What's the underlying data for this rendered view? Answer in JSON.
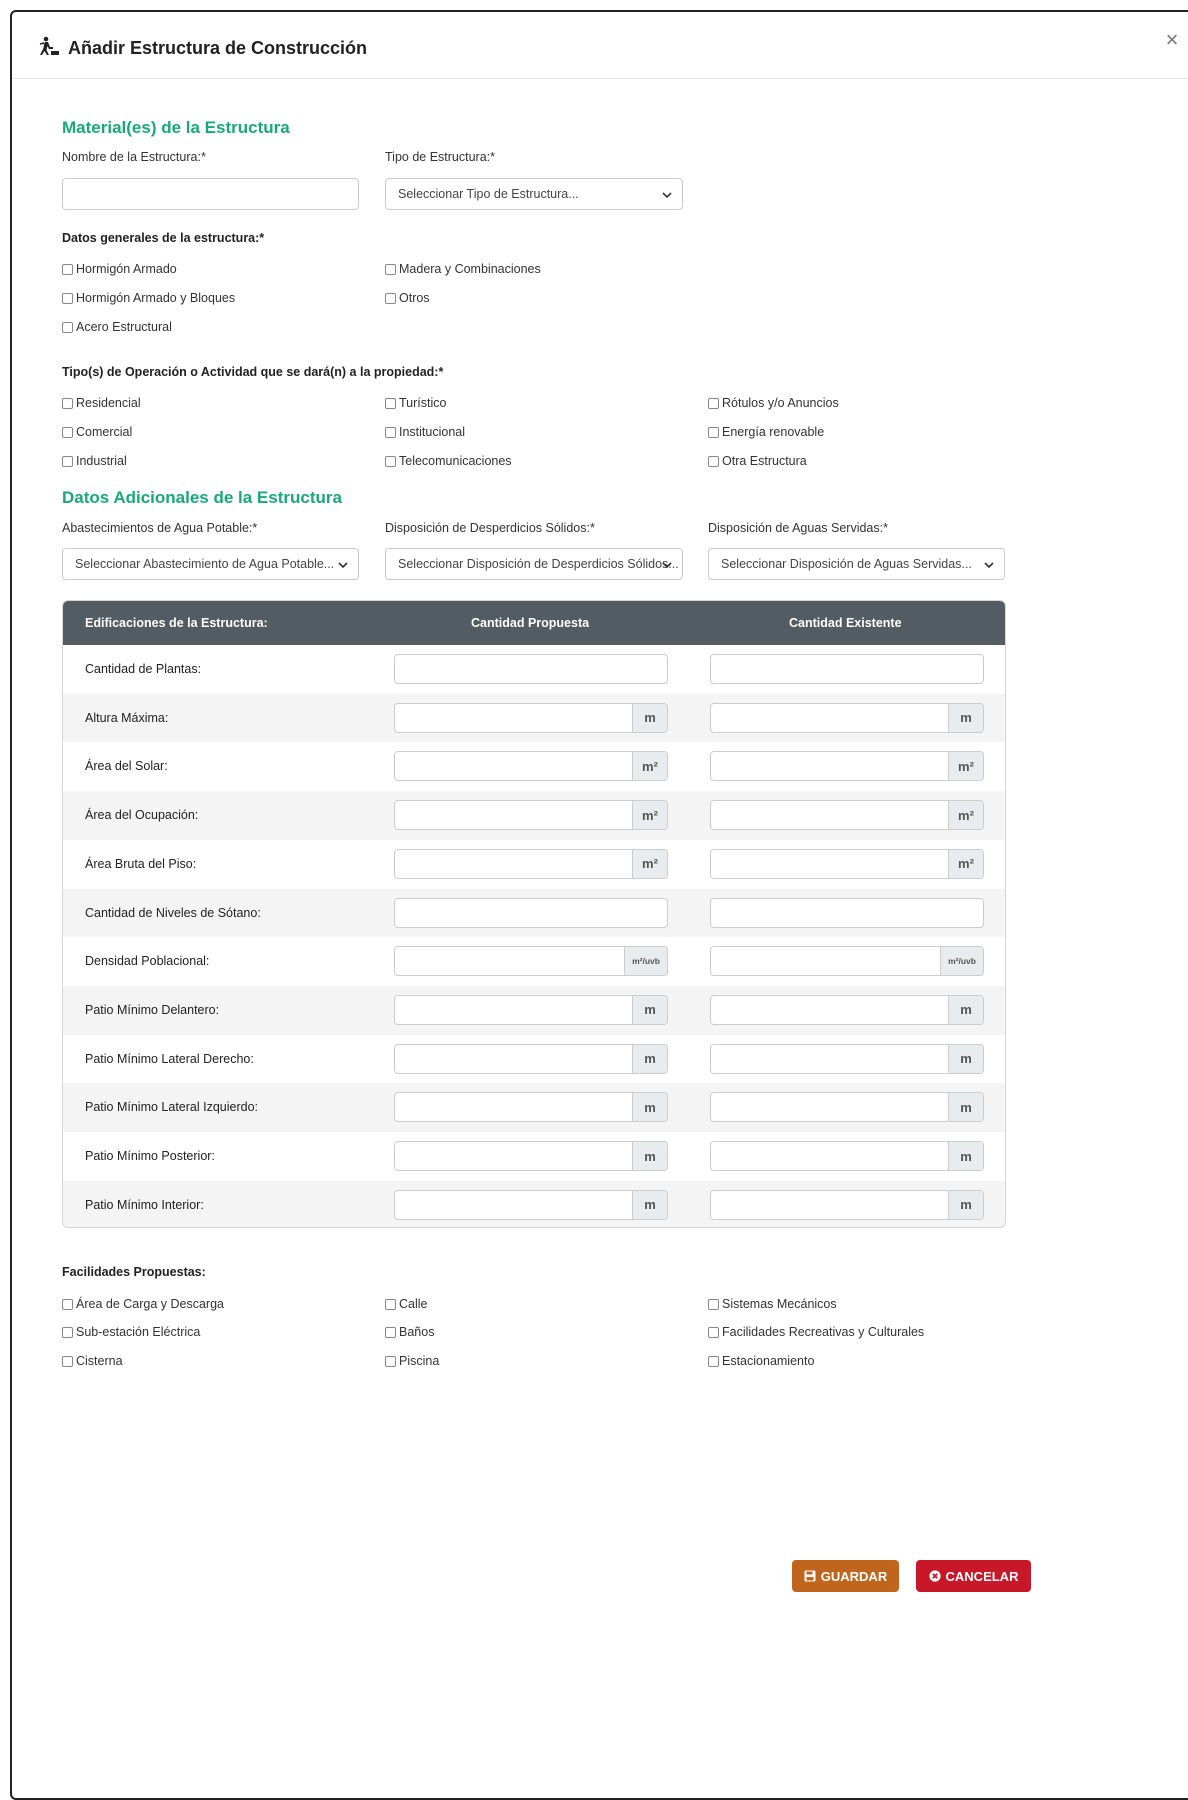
{
  "modal": {
    "title": "Añadir Estructura de Construcción",
    "close_symbol": "×",
    "title_icon": "worker-icon"
  },
  "colors": {
    "section": "#19a979",
    "table_header": "#525c62",
    "save": "#c0651e",
    "cancel": "#c9172a"
  },
  "section_materials": {
    "title": "Material(es) de la Estructura",
    "name_label": "Nombre de la Estructura:*",
    "name_value": "",
    "type_label": "Tipo de Estructura:*",
    "type_select": "Seleccionar Tipo de Estructura..."
  },
  "general_data": {
    "label": "Datos generales de la estructura:*",
    "options": [
      "Hormigón Armado",
      "Madera y Combinaciones",
      "Hormigón Armado y Bloques",
      "Otros",
      "Acero Estructural"
    ]
  },
  "operation_types": {
    "label": "Tipo(s) de Operación o Actividad que se dará(n) a la propiedad:*",
    "options": [
      "Residencial",
      "Turístico",
      "Rótulos y/o Anuncios",
      "Comercial",
      "Institucional",
      "Energía renovable",
      "Industrial",
      "Telecomunicaciones",
      "Otra Estructura"
    ]
  },
  "section_additional": {
    "title": "Datos Adicionales de la Estructura",
    "water_label": "Abastecimientos de Agua Potable:*",
    "water_select": "Seleccionar Abastecimiento de Agua Potable...",
    "solid_label": "Disposición de Desperdicios Sólidos:*",
    "solid_select": "Seleccionar Disposición de Desperdicios Sólidos...",
    "sewage_label": "Disposición de Aguas Servidas:*",
    "sewage_select": "Seleccionar Disposición de Aguas Servidas..."
  },
  "table": {
    "headers": [
      "Edificaciones de la Estructura:",
      "Cantidad Propuesta",
      "Cantidad Existente"
    ],
    "rows": [
      {
        "label": "Cantidad de Plantas:",
        "unit": ""
      },
      {
        "label": "Altura Máxima:",
        "unit": "m"
      },
      {
        "label": "Área del Solar:",
        "unit": "m²"
      },
      {
        "label": "Área del Ocupación:",
        "unit": "m²"
      },
      {
        "label": "Área Bruta del Piso:",
        "unit": "m²"
      },
      {
        "label": "Cantidad de Niveles de Sótano:",
        "unit": ""
      },
      {
        "label": "Densidad Poblacional:",
        "unit": "m²/uvb"
      },
      {
        "label": "Patio Mínimo Delantero:",
        "unit": "m"
      },
      {
        "label": "Patio Mínimo Lateral Derecho:",
        "unit": "m"
      },
      {
        "label": "Patio Mínimo Lateral Izquierdo:",
        "unit": "m"
      },
      {
        "label": "Patio Mínimo Posterior:",
        "unit": "m"
      },
      {
        "label": "Patio Mínimo Interior:",
        "unit": "m"
      }
    ]
  },
  "facilities": {
    "label": "Facilidades Propuestas:",
    "options": [
      "Área de Carga y Descarga",
      "Calle",
      "Sistemas Mecánicos",
      "Sub-estación Eléctrica",
      "Baños",
      "Facilidades Recreativas y Culturales",
      "Cisterna",
      "Piscina",
      "Estacionamiento"
    ]
  },
  "buttons": {
    "save": "GUARDAR",
    "cancel": "CANCELAR"
  }
}
